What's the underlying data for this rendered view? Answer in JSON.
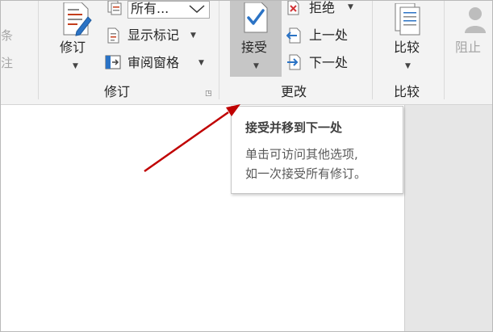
{
  "left_partial": {
    "text1": "条",
    "text2": "注"
  },
  "revision": {
    "track_changes_label": "修订",
    "markup_dropdown_value": "所有...",
    "show_markup_label": "显示标记",
    "reviewing_pane_label": "审阅窗格",
    "group_label": "修订"
  },
  "changes": {
    "accept_label": "接受",
    "reject_label": "拒绝",
    "previous_label": "上一处",
    "next_label": "下一处",
    "group_label": "更改"
  },
  "compare": {
    "compare_label": "比较",
    "group_label": "比较"
  },
  "protect": {
    "block_label": "阻止"
  },
  "tooltip": {
    "title": "接受并移到下一处",
    "line1": "单击可访问其他选项,",
    "line2": "如一次接受所有修订。"
  },
  "colors": {
    "ribbon_bg": "#f3f3f3",
    "accept_highlight": "#c6c6c6",
    "arrow": "#c00000",
    "check_blue": "#2b73c5"
  }
}
